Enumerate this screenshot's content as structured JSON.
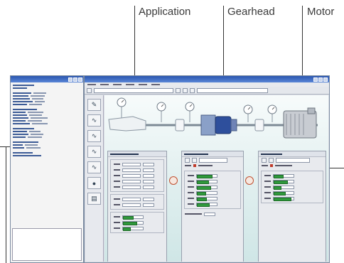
{
  "callouts": {
    "application": "Application",
    "gearhead": "Gearhead",
    "motor": "Motor"
  },
  "colors": {
    "title_bar": "#2a56b0",
    "bar_green": "#2f9a3c",
    "canvas_bg": "#e6f2f2",
    "callout_text": "#3a3a3a"
  },
  "icons": [
    "pressure-gauge-icon",
    "shaft-coupling-icon",
    "gearhead-icon",
    "motor-icon"
  ],
  "panels": {
    "application_bars": [
      0.55,
      0.7,
      0.4
    ],
    "gearhead_bars": [
      0.8,
      0.6,
      0.7,
      0.45,
      0.5,
      0.65
    ],
    "motor_bars": [
      0.5,
      0.7,
      0.4,
      0.6,
      0.9
    ]
  }
}
